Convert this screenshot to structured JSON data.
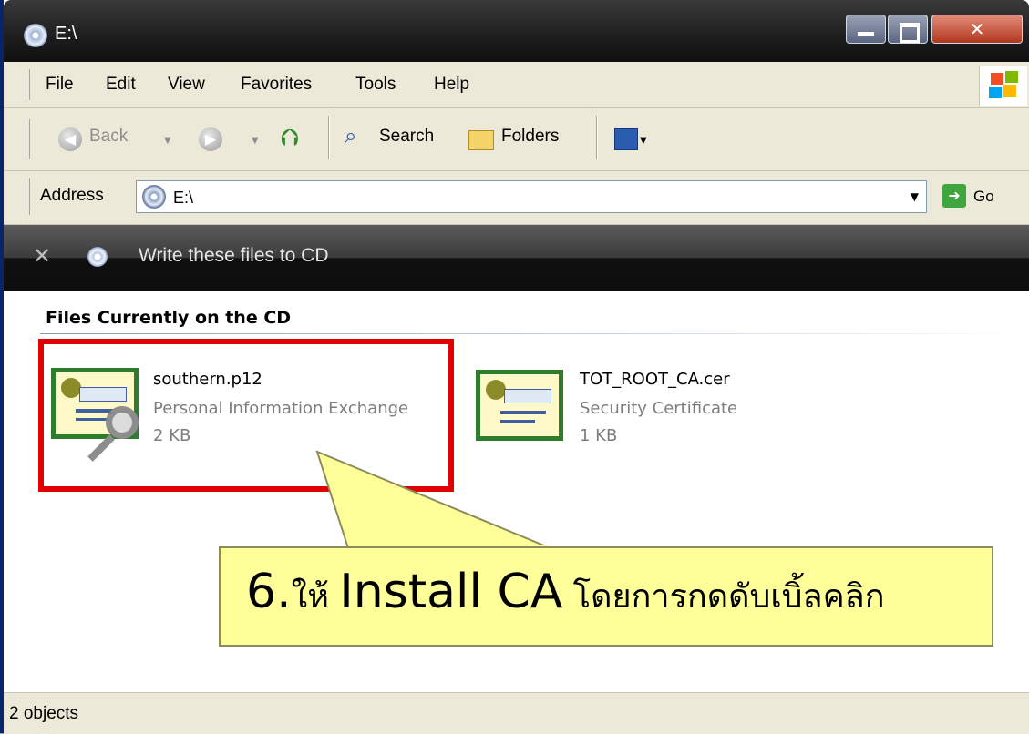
{
  "window": {
    "title": "E:\\"
  },
  "menu": [
    "File",
    "Edit",
    "View",
    "Favorites",
    "Tools",
    "Help"
  ],
  "toolbar": {
    "back_label": "Back",
    "search_label": "Search",
    "folders_label": "Folders"
  },
  "address": {
    "label": "Address",
    "value": "E:\\",
    "go_label": "Go"
  },
  "cd_task": {
    "label": "Write these files to CD"
  },
  "group": {
    "title": "Files Currently on the CD"
  },
  "files": [
    {
      "name": "southern.p12",
      "type": "Personal Information Exchange",
      "size": "2 KB",
      "icon": "certificate-key-icon"
    },
    {
      "name": "TOT_ROOT_CA.cer",
      "type": "Security Certificate",
      "size": "1 KB",
      "icon": "certificate-icon"
    }
  ],
  "callout": {
    "number": "6.",
    "prefix": "ให้ ",
    "emphasis": "Install CA",
    "suffix": " โดยการกดดับเบิ้ลคลิก"
  },
  "status": {
    "text": "2 objects"
  },
  "colors": {
    "highlight": "#e00000",
    "callout_bg": "#ffff99",
    "titlebar": "#1d1d1d",
    "close": "#b2371d"
  }
}
